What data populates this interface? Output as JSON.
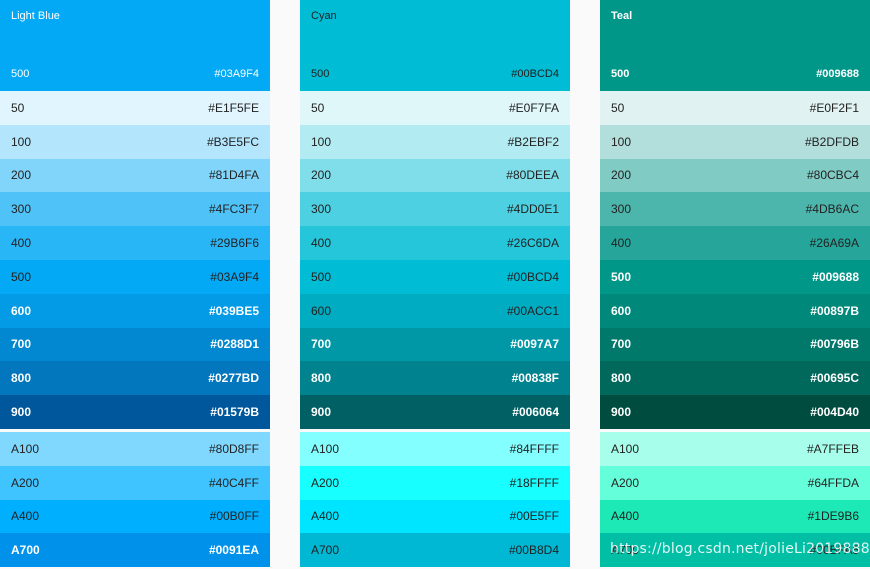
{
  "palettes": [
    {
      "title": "Light Blue",
      "primary": {
        "shade": "500",
        "hex": "#03A9F4"
      },
      "header_color": "#03A9F4",
      "header_text_color": "#FFFFFF",
      "header_title_bold": false,
      "shades": [
        {
          "shade": "50",
          "hex": "#E1F5FE",
          "text": "#222222",
          "bold": false
        },
        {
          "shade": "100",
          "hex": "#B3E5FC",
          "text": "#222222",
          "bold": false
        },
        {
          "shade": "200",
          "hex": "#81D4FA",
          "text": "#222222",
          "bold": false
        },
        {
          "shade": "300",
          "hex": "#4FC3F7",
          "text": "#222222",
          "bold": false
        },
        {
          "shade": "400",
          "hex": "#29B6F6",
          "text": "#222222",
          "bold": false
        },
        {
          "shade": "500",
          "hex": "#03A9F4",
          "text": "#222222",
          "bold": false
        },
        {
          "shade": "600",
          "hex": "#039BE5",
          "text": "#FFFFFF",
          "bold": true
        },
        {
          "shade": "700",
          "hex": "#0288D1",
          "text": "#FFFFFF",
          "bold": true
        },
        {
          "shade": "800",
          "hex": "#0277BD",
          "text": "#FFFFFF",
          "bold": true
        },
        {
          "shade": "900",
          "hex": "#01579B",
          "text": "#FFFFFF",
          "bold": true
        }
      ],
      "accents": [
        {
          "shade": "A100",
          "hex": "#80D8FF",
          "text": "#222222",
          "bold": false
        },
        {
          "shade": "A200",
          "hex": "#40C4FF",
          "text": "#222222",
          "bold": false
        },
        {
          "shade": "A400",
          "hex": "#00B0FF",
          "text": "#222222",
          "bold": false
        },
        {
          "shade": "A700",
          "hex": "#0091EA",
          "text": "#FFFFFF",
          "bold": true
        }
      ]
    },
    {
      "title": "Cyan",
      "primary": {
        "shade": "500",
        "hex": "#00BCD4"
      },
      "header_color": "#00BCD4",
      "header_text_color": "#222222",
      "header_title_bold": false,
      "shades": [
        {
          "shade": "50",
          "hex": "#E0F7FA",
          "text": "#222222",
          "bold": false
        },
        {
          "shade": "100",
          "hex": "#B2EBF2",
          "text": "#222222",
          "bold": false
        },
        {
          "shade": "200",
          "hex": "#80DEEA",
          "text": "#222222",
          "bold": false
        },
        {
          "shade": "300",
          "hex": "#4DD0E1",
          "text": "#222222",
          "bold": false
        },
        {
          "shade": "400",
          "hex": "#26C6DA",
          "text": "#222222",
          "bold": false
        },
        {
          "shade": "500",
          "hex": "#00BCD4",
          "text": "#222222",
          "bold": false
        },
        {
          "shade": "600",
          "hex": "#00ACC1",
          "text": "#222222",
          "bold": false
        },
        {
          "shade": "700",
          "hex": "#0097A7",
          "text": "#FFFFFF",
          "bold": true
        },
        {
          "shade": "800",
          "hex": "#00838F",
          "text": "#FFFFFF",
          "bold": true
        },
        {
          "shade": "900",
          "hex": "#006064",
          "text": "#FFFFFF",
          "bold": true
        }
      ],
      "accents": [
        {
          "shade": "A100",
          "hex": "#84FFFF",
          "text": "#222222",
          "bold": false
        },
        {
          "shade": "A200",
          "hex": "#18FFFF",
          "text": "#222222",
          "bold": false
        },
        {
          "shade": "A400",
          "hex": "#00E5FF",
          "text": "#222222",
          "bold": false
        },
        {
          "shade": "A700",
          "hex": "#00B8D4",
          "text": "#222222",
          "bold": false
        }
      ]
    },
    {
      "title": "Teal",
      "primary": {
        "shade": "500",
        "hex": "#009688"
      },
      "header_color": "#009688",
      "header_text_color": "#FFFFFF",
      "header_title_bold": true,
      "shades": [
        {
          "shade": "50",
          "hex": "#E0F2F1",
          "text": "#222222",
          "bold": false
        },
        {
          "shade": "100",
          "hex": "#B2DFDB",
          "text": "#222222",
          "bold": false
        },
        {
          "shade": "200",
          "hex": "#80CBC4",
          "text": "#222222",
          "bold": false
        },
        {
          "shade": "300",
          "hex": "#4DB6AC",
          "text": "#222222",
          "bold": false
        },
        {
          "shade": "400",
          "hex": "#26A69A",
          "text": "#222222",
          "bold": false
        },
        {
          "shade": "500",
          "hex": "#009688",
          "text": "#FFFFFF",
          "bold": true
        },
        {
          "shade": "600",
          "hex": "#00897B",
          "text": "#FFFFFF",
          "bold": true
        },
        {
          "shade": "700",
          "hex": "#00796B",
          "text": "#FFFFFF",
          "bold": true
        },
        {
          "shade": "800",
          "hex": "#00695C",
          "text": "#FFFFFF",
          "bold": true
        },
        {
          "shade": "900",
          "hex": "#004D40",
          "text": "#FFFFFF",
          "bold": true
        }
      ],
      "accents": [
        {
          "shade": "A100",
          "hex": "#A7FFEB",
          "text": "#222222",
          "bold": false
        },
        {
          "shade": "A200",
          "hex": "#64FFDA",
          "text": "#222222",
          "bold": false
        },
        {
          "shade": "A400",
          "hex": "#1DE9B6",
          "text": "#222222",
          "bold": false
        },
        {
          "shade": "A700",
          "hex": "#00BFA5",
          "text": "#222222",
          "bold": false
        }
      ]
    }
  ],
  "watermark": "https://blog.csdn.net/jolieLi2019888"
}
